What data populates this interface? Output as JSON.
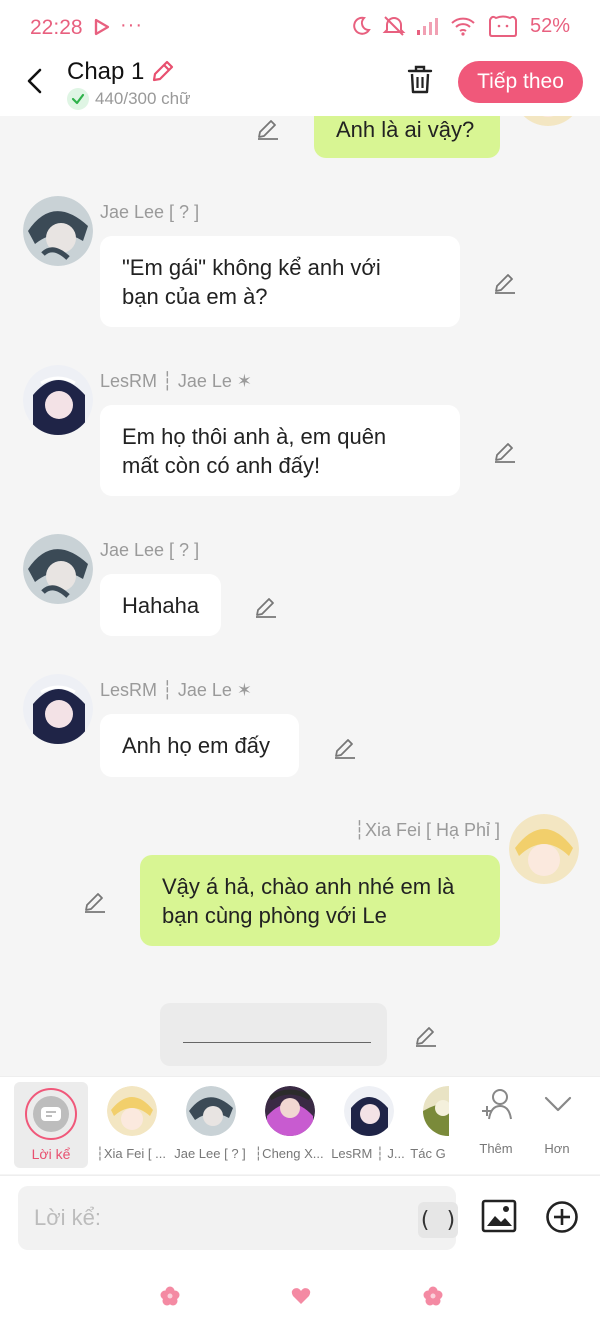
{
  "status": {
    "time": "22:28",
    "battery": "52%",
    "colors": {
      "accent": "#e8607f"
    }
  },
  "header": {
    "title": "Chap 1",
    "word_count": "440/300 chữ",
    "next_label": "Tiếp theo",
    "accent": "#f0587a"
  },
  "messages": {
    "m0": {
      "text": "Anh là ai vậy?"
    },
    "m1": {
      "sender": "Jae Lee [ ? ]",
      "line1": "\"Em gái\" không kể anh với",
      "line2": "bạn của em à?"
    },
    "m2": {
      "sender": "LesRM ┆ Jae Le ✶",
      "line1": "Em họ thôi anh à, em quên",
      "line2": "mất còn có anh đấy!"
    },
    "m3": {
      "sender": "Jae Lee [ ? ]",
      "text": "Hahaha"
    },
    "m4": {
      "sender": "LesRM ┆ Jae Le ✶",
      "text": "Anh họ em đấy"
    },
    "m5": {
      "sender": "┆Xia Fei [ Hạ Phỉ ]",
      "line1": "Vậy á hả, chào anh nhé em là",
      "line2": "bạn cùng phòng với Le"
    }
  },
  "characters": {
    "narrator": {
      "label": "Lời kể"
    },
    "items": [
      {
        "label": "┆Xia Fei [ ..."
      },
      {
        "label": "Jae Lee [ ? ]"
      },
      {
        "label": "┆Cheng X..."
      },
      {
        "label": "LesRM ┆ J..."
      },
      {
        "label": "Tác G"
      }
    ],
    "add_label": "Thêm",
    "more_label": "Hơn"
  },
  "input": {
    "placeholder": "Lời kể:",
    "paren_label": "( )"
  },
  "colors": {
    "bubble_green": "#d8f593",
    "bubble_white": "#ffffff",
    "background": "#f5f5f5"
  }
}
